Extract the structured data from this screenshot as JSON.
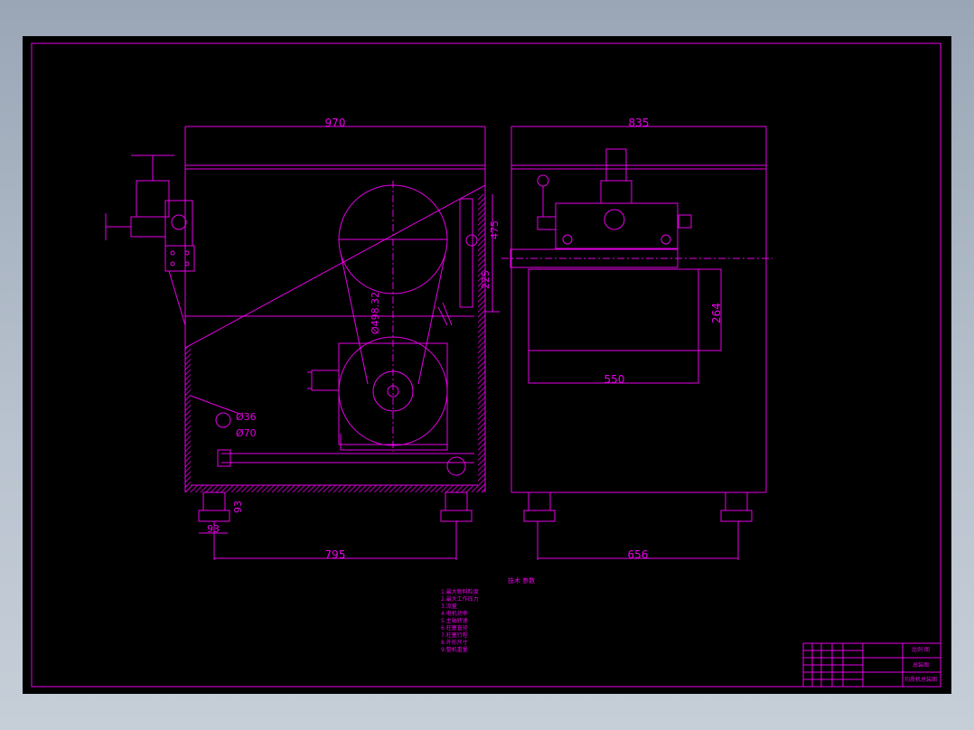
{
  "colors": {
    "background": "#000000",
    "lines": "#e600e6",
    "window": "#b3bdc9"
  },
  "front_view": {
    "dim_width": "970",
    "dim_base": "795",
    "dim_foot_w": "93",
    "dim_foot_h": "93",
    "dim_pulley": "Ø498.32",
    "dim_right_1": "475",
    "dim_right_2": "225",
    "dim_small_1": "Ø36",
    "dim_small_2": "Ø70"
  },
  "side_view": {
    "dim_width": "835",
    "dim_base": "656",
    "dim_tank_w": "550",
    "dim_tank_h": "264"
  },
  "notes": {
    "heading": "技术 参数",
    "lines": [
      "1.最大物料粒度",
      "2.最大工作压力",
      "3.流量",
      "4.电机功率",
      "5.主轴转速",
      "6.柱塞直径",
      "7.柱塞行程",
      "8.外形尺寸",
      "9.整机重量"
    ]
  },
  "title_block": {
    "row1": "比例 图",
    "row2": "总装图",
    "row3": "均质机总装图"
  }
}
